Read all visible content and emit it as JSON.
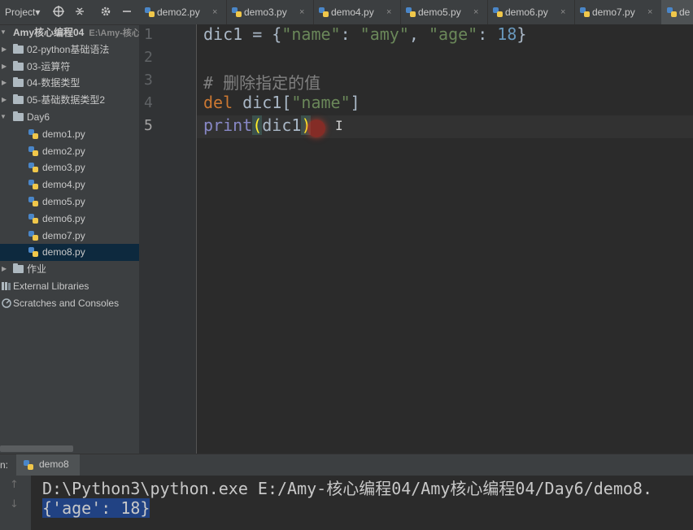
{
  "project_panel": {
    "title": "Project▾",
    "toolbar_icons": [
      "target-icon",
      "collapse-icon",
      "gear-icon",
      "minimize-icon"
    ],
    "root": {
      "label": "Amy核心编程04",
      "path": "E:\\Amy-核心"
    },
    "items": [
      {
        "label": "02-python基础语法"
      },
      {
        "label": "03-运算符"
      },
      {
        "label": "04-数据类型"
      },
      {
        "label": "05-基础数据类型2"
      },
      {
        "label": "Day6"
      },
      {
        "label": "demo1.py"
      },
      {
        "label": "demo2.py"
      },
      {
        "label": "demo3.py"
      },
      {
        "label": "demo4.py"
      },
      {
        "label": "demo5.py"
      },
      {
        "label": "demo6.py"
      },
      {
        "label": "demo7.py"
      },
      {
        "label": "demo8.py"
      },
      {
        "label": "作业"
      },
      {
        "label": "External Libraries"
      },
      {
        "label": "Scratches and Consoles"
      }
    ]
  },
  "tabs": [
    {
      "label": "demo2.py",
      "close": "×"
    },
    {
      "label": "demo3.py",
      "close": "×"
    },
    {
      "label": "demo4.py",
      "close": "×"
    },
    {
      "label": "demo5.py",
      "close": "×"
    },
    {
      "label": "demo6.py",
      "close": "×"
    },
    {
      "label": "demo7.py",
      "close": "×"
    },
    {
      "label": "de"
    }
  ],
  "editor": {
    "line_numbers": [
      "1",
      "2",
      "3",
      "4",
      "5"
    ],
    "lines": [
      [
        "dic1 = {",
        "\"name\"",
        ": ",
        "\"amy\"",
        ", ",
        "\"age\"",
        ": ",
        "18",
        "}"
      ],
      [],
      [
        "# 删除指定的值"
      ],
      [
        "del",
        " dic1[",
        "\"name\"",
        "]"
      ],
      [
        "print",
        "(",
        "dic1",
        ")"
      ]
    ]
  },
  "run": {
    "prefix": "n:",
    "tab_label": "demo8",
    "controls": [
      "↑",
      "↓"
    ],
    "output": [
      "D:\\Python3\\python.exe E:/Amy-核心编程04/Amy核心编程04/Day6/demo8.",
      "{'age': 18}"
    ]
  },
  "colors": {
    "keyword": "#cc7832",
    "string": "#6a8759",
    "number": "#6897bb",
    "comment": "#808080",
    "selection": "#0d293e"
  }
}
